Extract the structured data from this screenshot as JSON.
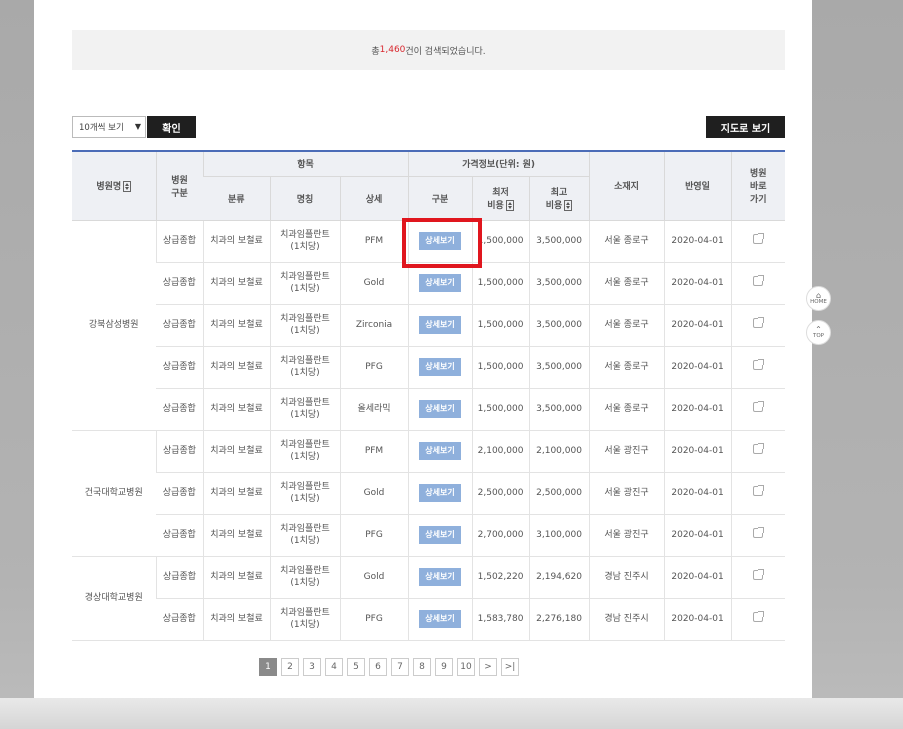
{
  "summary": {
    "prefix": "총 ",
    "count": "1,460",
    "suffix": "건이 검색되었습니다."
  },
  "controls": {
    "page_size": "10개씩 보기",
    "confirm_label": "확인",
    "map_label": "지도로 보기"
  },
  "table": {
    "headers": {
      "hospital_name": "병원명",
      "hospital_type": "병원\n구분",
      "item_group": "항목",
      "price_group": "가격정보(단위: 원)",
      "location": "소재지",
      "applied_date": "반영일",
      "shortcut": "병원\n바로\n가기",
      "category": "분류",
      "name": "명칭",
      "detail": "상세",
      "division": "구분",
      "min_cost": "최저\n비용",
      "max_cost": "최고\n비용"
    },
    "detail_button_label": "상세보기",
    "hospitals": [
      {
        "name": "강북삼성병원",
        "rows": [
          {
            "type": "상급종합",
            "category": "치과의 보철료",
            "item_name": "치과임플란트\n(1치당)",
            "detail": "PFM",
            "min": "1,500,000",
            "max": "3,500,000",
            "location": "서울 종로구",
            "date": "2020-04-01"
          },
          {
            "type": "상급종합",
            "category": "치과의 보철료",
            "item_name": "치과임플란트\n(1치당)",
            "detail": "Gold",
            "min": "1,500,000",
            "max": "3,500,000",
            "location": "서울 종로구",
            "date": "2020-04-01"
          },
          {
            "type": "상급종합",
            "category": "치과의 보철료",
            "item_name": "치과임플란트\n(1치당)",
            "detail": "Zirconia",
            "min": "1,500,000",
            "max": "3,500,000",
            "location": "서울 종로구",
            "date": "2020-04-01"
          },
          {
            "type": "상급종합",
            "category": "치과의 보철료",
            "item_name": "치과임플란트\n(1치당)",
            "detail": "PFG",
            "min": "1,500,000",
            "max": "3,500,000",
            "location": "서울 종로구",
            "date": "2020-04-01"
          },
          {
            "type": "상급종합",
            "category": "치과의 보철료",
            "item_name": "치과임플란트\n(1치당)",
            "detail": "올세라믹",
            "min": "1,500,000",
            "max": "3,500,000",
            "location": "서울 종로구",
            "date": "2020-04-01"
          }
        ]
      },
      {
        "name": "건국대학교병원",
        "rows": [
          {
            "type": "상급종합",
            "category": "치과의 보철료",
            "item_name": "치과임플란트\n(1치당)",
            "detail": "PFM",
            "min": "2,100,000",
            "max": "2,100,000",
            "location": "서울 광진구",
            "date": "2020-04-01"
          },
          {
            "type": "상급종합",
            "category": "치과의 보철료",
            "item_name": "치과임플란트\n(1치당)",
            "detail": "Gold",
            "min": "2,500,000",
            "max": "2,500,000",
            "location": "서울 광진구",
            "date": "2020-04-01"
          },
          {
            "type": "상급종합",
            "category": "치과의 보철료",
            "item_name": "치과임플란트\n(1치당)",
            "detail": "PFG",
            "min": "2,700,000",
            "max": "3,100,000",
            "location": "서울 광진구",
            "date": "2020-04-01"
          }
        ]
      },
      {
        "name": "경상대학교병원",
        "rows": [
          {
            "type": "상급종합",
            "category": "치과의 보철료",
            "item_name": "치과임플란트\n(1치당)",
            "detail": "Gold",
            "min": "1,502,220",
            "max": "2,194,620",
            "location": "경남 진주시",
            "date": "2020-04-01"
          },
          {
            "type": "상급종합",
            "category": "치과의 보철료",
            "item_name": "치과임플란트\n(1치당)",
            "detail": "PFG",
            "min": "1,583,780",
            "max": "2,276,180",
            "location": "경남 진주시",
            "date": "2020-04-01"
          }
        ]
      }
    ]
  },
  "pagination": {
    "pages": [
      "1",
      "2",
      "3",
      "4",
      "5",
      "6",
      "7",
      "8",
      "9",
      "10"
    ],
    "current": "1",
    "next": ">",
    "last": ">|"
  },
  "side": {
    "home_label": "HOME",
    "top_label": "TOP"
  },
  "colors": {
    "accent": "#d9282f",
    "header_line": "#4b6cb7",
    "detail_button": "#8fb0dc",
    "highlight": "#e0161e"
  }
}
